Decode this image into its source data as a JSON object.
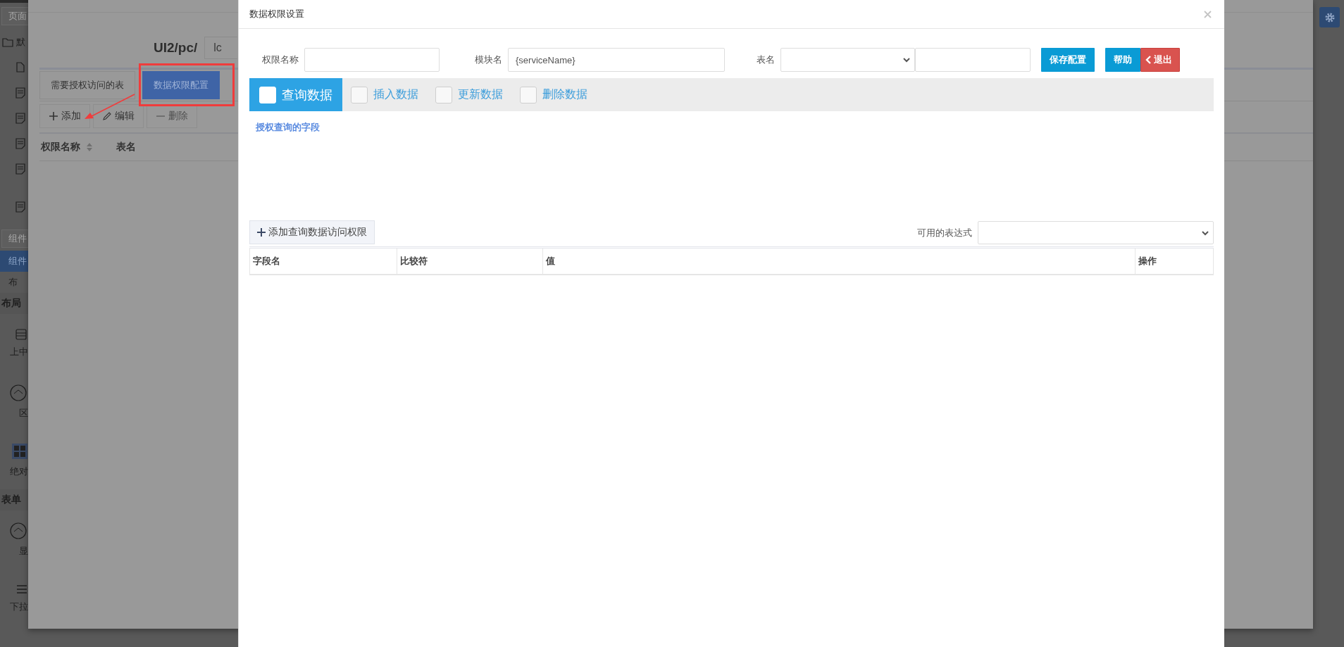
{
  "background": {
    "page_search": {
      "placeholder": "页面"
    },
    "tree": [
      {
        "kind": "folder",
        "label": "默"
      },
      {
        "kind": "page"
      },
      {
        "kind": "form"
      },
      {
        "kind": "form"
      },
      {
        "kind": "form"
      },
      {
        "kind": "form"
      },
      {
        "kind": "form"
      }
    ],
    "component_search": {
      "placeholder": "组件"
    },
    "palette_tabs": [
      {
        "label": "组件",
        "selected": true
      },
      {
        "label": "布",
        "selected": false
      }
    ],
    "sections": [
      {
        "title": "布局",
        "items": [
          {
            "kind": "rows",
            "label": "上中"
          },
          {
            "kind": "circle",
            "label": "区"
          },
          {
            "kind": "grid",
            "label": "绝对"
          }
        ]
      },
      {
        "title": "表单",
        "items": [
          {
            "kind": "circle",
            "label": "显"
          },
          {
            "kind": "list",
            "label": "下拉"
          }
        ]
      }
    ]
  },
  "dialog": {
    "path_label": "UI2/pc/",
    "path_field": {
      "value": "lc"
    },
    "tabs": [
      {
        "label": "需要授权访问的表",
        "selected": false
      },
      {
        "label": "数据权限配置",
        "selected": true
      }
    ],
    "toolbar": [
      {
        "kind": "add",
        "label": "添加",
        "disabled": false
      },
      {
        "kind": "edit",
        "label": "编辑",
        "disabled": false
      },
      {
        "kind": "remove",
        "label": "删除",
        "disabled": true
      }
    ],
    "table": {
      "columns": [
        {
          "label": "权限名称",
          "sortable": true
        },
        {
          "label": "表名",
          "sortable": false
        }
      ]
    }
  },
  "modal": {
    "title": "数据权限设置",
    "fields": [
      {
        "kind": "text",
        "label": "权限名称"
      },
      {
        "kind": "text",
        "label": "模块名",
        "value": "{serviceName}"
      },
      {
        "kind": "select_text",
        "label": "表名"
      }
    ],
    "buttons": [
      {
        "kind": "primary",
        "label": "保存配置"
      },
      {
        "kind": "primary",
        "label": "帮助"
      },
      {
        "kind": "danger",
        "label": "退出"
      }
    ],
    "operation_tabs": [
      {
        "label": "查询数据",
        "selected": true,
        "checked": false
      },
      {
        "label": "插入数据",
        "selected": false,
        "checked": false
      },
      {
        "label": "更新数据",
        "selected": false,
        "checked": false
      },
      {
        "label": "删除数据",
        "selected": false,
        "checked": false
      }
    ],
    "section_label": "授权查询的字段",
    "add_button": "添加查询数据访问权限",
    "expression": {
      "label": "可用的表达式"
    },
    "table": {
      "columns": [
        "字段名",
        "比较符",
        "值",
        "操作"
      ]
    }
  }
}
